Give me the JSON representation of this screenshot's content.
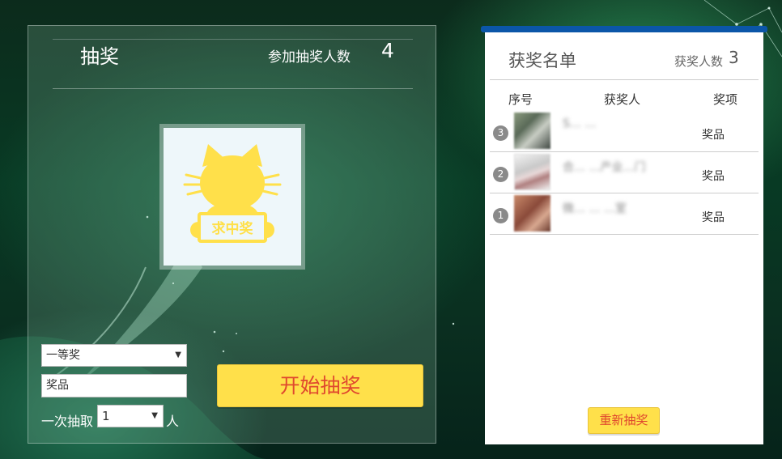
{
  "left": {
    "title": "抽奖",
    "participants_label": "参加抽奖人数",
    "participants_count": "4",
    "avatar_text": "求中奖",
    "prize_level": "一等奖",
    "prize_input_value": "奖品",
    "draw_prefix": "一次抽取",
    "draw_count": "1",
    "draw_unit": "人",
    "start_button": "开始抽奖"
  },
  "right": {
    "title": "获奖名单",
    "winners_label": "获奖人数",
    "winners_count": "3",
    "columns": {
      "index": "序号",
      "winner": "获奖人",
      "prize": "奖项"
    },
    "rows": [
      {
        "rank": "3",
        "name": "S… …",
        "prize": "奖品"
      },
      {
        "rank": "2",
        "name": "合… …产业…门",
        "prize": "奖品"
      },
      {
        "rank": "1",
        "name": "微… … …室",
        "prize": "奖品"
      }
    ],
    "redraw_button": "重新抽奖"
  },
  "colors": {
    "button_yellow": "#ffe04a",
    "button_text": "#e0482e",
    "cat_yellow": "#ffe04a",
    "header_blue": "#0b56a8"
  },
  "icons": {
    "mascot": "cat-mascot-icon",
    "caret": "chevron-down-icon"
  }
}
